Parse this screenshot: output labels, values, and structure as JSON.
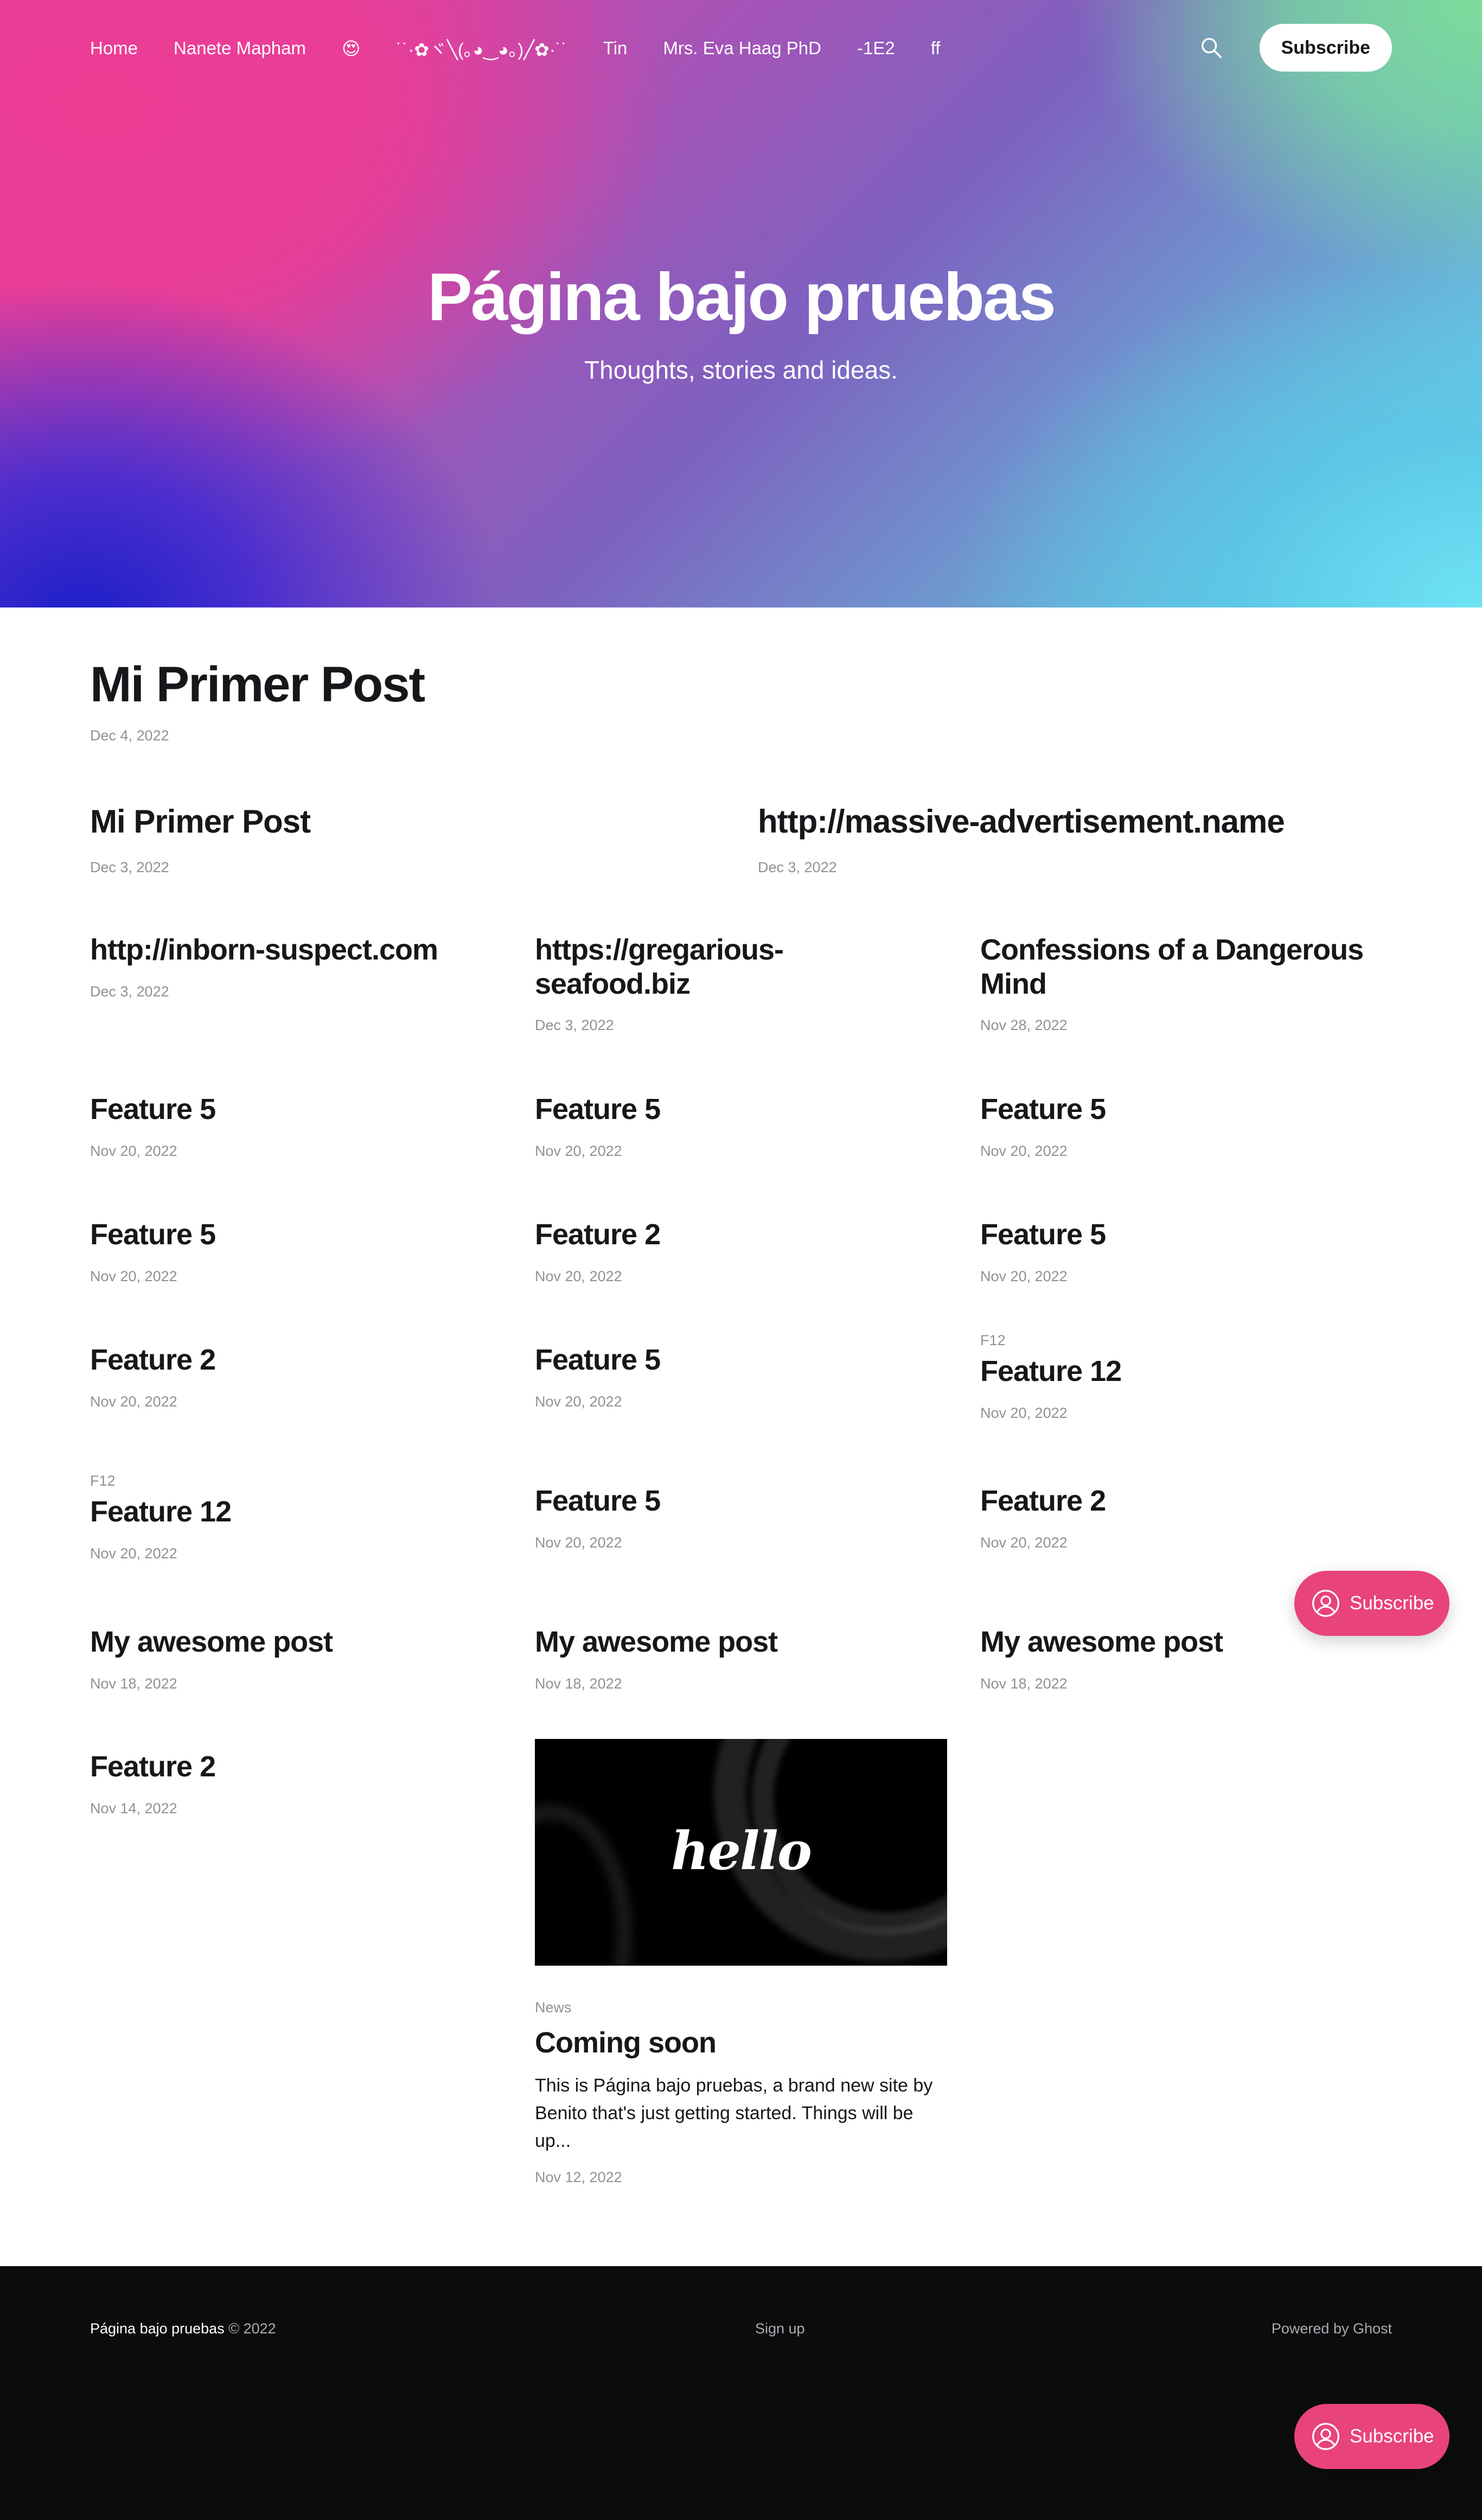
{
  "nav": {
    "items": [
      "Home",
      "Nanete Mapham",
      "😍",
      "˙˙·✿ヾ╲(｡◕‿◕｡)╱✿·˙˙",
      "Tin",
      "Mrs. Eva Haag PhD",
      "-1E2",
      "ff"
    ],
    "search_icon": "search-icon",
    "subscribe": "Subscribe"
  },
  "hero": {
    "title": "Página bajo pruebas",
    "description": "Thoughts, stories and ideas."
  },
  "posts": [
    {
      "title": "Mi Primer Post",
      "date": "Dec 4, 2022"
    },
    {
      "title": "Mi Primer Post",
      "date": "Dec 3, 2022"
    },
    {
      "title": "http://massive-advertisement.name",
      "date": "Dec 3, 2022"
    },
    {
      "title": "http://inborn-suspect.com",
      "date": "Dec 3, 2022"
    },
    {
      "title": "https://gregarious-seafood.biz",
      "date": "Dec 3, 2022"
    },
    {
      "title": "Confessions of a Dangerous Mind",
      "date": "Nov 28, 2022"
    },
    {
      "title": "Feature 5",
      "date": "Nov 20, 2022"
    },
    {
      "title": "Feature 5",
      "date": "Nov 20, 2022"
    },
    {
      "title": "Feature 5",
      "date": "Nov 20, 2022"
    },
    {
      "title": "Feature 5",
      "date": "Nov 20, 2022"
    },
    {
      "title": "Feature 2",
      "date": "Nov 20, 2022"
    },
    {
      "title": "Feature 5",
      "date": "Nov 20, 2022"
    },
    {
      "title": "Feature 2",
      "date": "Nov 20, 2022"
    },
    {
      "title": "Feature 5",
      "date": "Nov 20, 2022"
    },
    {
      "tag": "F12",
      "title": "Feature 12",
      "date": "Nov 20, 2022"
    },
    {
      "tag": "F12",
      "title": "Feature 12",
      "date": "Nov 20, 2022"
    },
    {
      "title": "Feature 5",
      "date": "Nov 20, 2022"
    },
    {
      "title": "Feature 2",
      "date": "Nov 20, 2022"
    },
    {
      "title": "My awesome post",
      "date": "Nov 18, 2022"
    },
    {
      "title": "My awesome post",
      "date": "Nov 18, 2022"
    },
    {
      "title": "My awesome post",
      "date": "Nov 18, 2022"
    },
    {
      "title": "Feature 2",
      "date": "Nov 14, 2022"
    },
    {
      "image_text": "hello",
      "tag": "News",
      "title": "Coming soon",
      "excerpt": "This is Página bajo pruebas, a brand new site by Benito that's just getting started. Things will be up...",
      "date": "Nov 12, 2022"
    }
  ],
  "footer": {
    "site": "Página bajo pruebas",
    "copyright": " © 2022",
    "signup": "Sign up",
    "powered": "Powered by Ghost"
  },
  "portal": {
    "label": "Subscribe",
    "icon": "user-circle-icon",
    "color": "#e8437a"
  }
}
